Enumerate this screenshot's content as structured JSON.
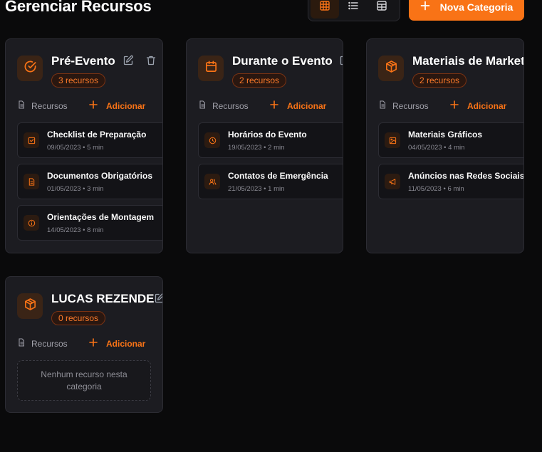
{
  "page": {
    "title": "Gerenciar Recursos"
  },
  "view_modes": [
    {
      "name": "grid",
      "icon": "grid-icon",
      "active": true
    },
    {
      "name": "list",
      "icon": "list-icon",
      "active": false
    },
    {
      "name": "table",
      "icon": "table-icon",
      "active": false
    }
  ],
  "actions": {
    "new_category_label": "Nova Categoria"
  },
  "colors": {
    "accent": "#f97316",
    "card_bg": "#1c1c21",
    "page_bg": "#0a0a0b"
  },
  "section_labels": {
    "resources": "Recursos",
    "add": "Adicionar"
  },
  "categories": [
    {
      "title": "Pré-Evento",
      "icon": "check-circle-icon",
      "badge": "3 recursos",
      "resources": [
        {
          "name": "Checklist de Preparação",
          "meta": "09/05/2023 • 5 min",
          "icon": "checkbox-icon"
        },
        {
          "name": "Documentos Obrigatórios",
          "meta": "01/05/2023 • 3 min",
          "icon": "document-icon"
        },
        {
          "name": "Orientações de Montagem",
          "meta": "14/05/2023 • 8 min",
          "icon": "info-icon"
        }
      ]
    },
    {
      "title": "Durante o Evento",
      "icon": "calendar-icon",
      "badge": "2 recursos",
      "resources": [
        {
          "name": "Horários do Evento",
          "meta": "19/05/2023 • 2 min",
          "icon": "clock-icon"
        },
        {
          "name": "Contatos de Emergência",
          "meta": "21/05/2023 • 1 min",
          "icon": "users-icon"
        }
      ]
    },
    {
      "title": "Materiais de Marketing",
      "icon": "box-icon",
      "badge": "2 recursos",
      "resources": [
        {
          "name": "Materiais Gráficos",
          "meta": "04/05/2023 • 4 min",
          "icon": "image-icon"
        },
        {
          "name": "Anúncios nas Redes Sociais",
          "meta": "11/05/2023 • 6 min",
          "icon": "megaphone-icon"
        }
      ]
    },
    {
      "title": "LUCAS REZENDE",
      "icon": "box-icon",
      "badge": "0 recursos",
      "resources": [],
      "empty_text": "Nenhum recurso nesta categoria"
    }
  ]
}
